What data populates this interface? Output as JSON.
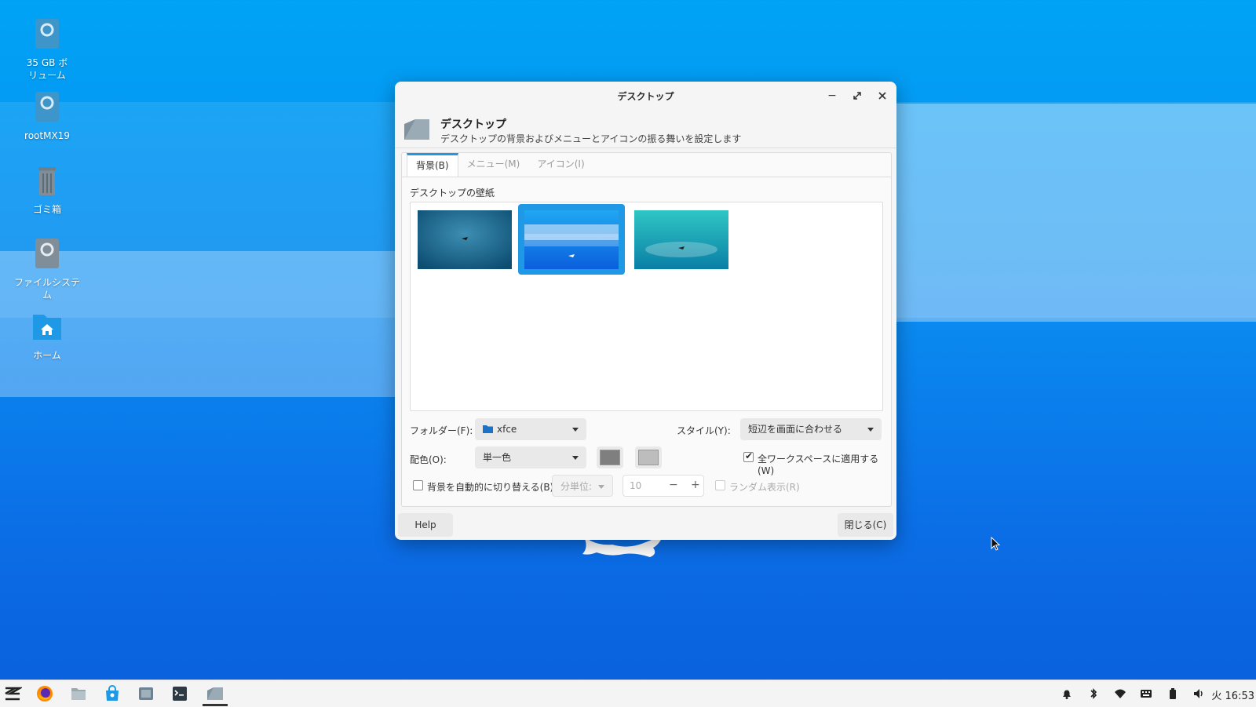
{
  "desktop": {
    "icons": [
      {
        "label": "35 GB ボ\nリューム",
        "icon": "drive-icon"
      },
      {
        "label": "rootMX19",
        "icon": "drive-icon"
      },
      {
        "label": "ゴミ箱",
        "icon": "trash-icon"
      },
      {
        "label": "ファイルシステ\nム",
        "icon": "drive-icon"
      },
      {
        "label": "ホーム",
        "icon": "home-folder-icon"
      }
    ]
  },
  "dialog": {
    "window_title": "デスクトップ",
    "header_title": "デスクトップ",
    "header_subtitle": "デスクトップの背景およびメニューとアイコンの振る舞いを設定します",
    "tabs": [
      "背景(B)",
      "メニュー(M)",
      "アイコン(I)"
    ],
    "active_tab": 0,
    "wallpaper_label": "デスクトップの壁紙",
    "selected_wallpaper": 1,
    "folder_label": "フォルダー(F):",
    "folder_value": "xfce",
    "style_label": "スタイル(Y):",
    "style_value": "短辺を画面に合わせる",
    "color_label": "配色(O):",
    "color_value": "単一色",
    "color1": "#7f7f7f",
    "color2": "#bdbdbd",
    "apply_all_label": "全ワークスペースに適用する(W)",
    "apply_all_checked": true,
    "auto_change_label": "背景を自動的に切り替える(B)",
    "auto_change_checked": false,
    "interval_unit": "分単位:",
    "interval_value": "10",
    "random_label": "ランダム表示(R)",
    "help_label": "Help",
    "close_label": "閉じる(C)"
  },
  "taskbar": {
    "clock": "火 16:53",
    "accent": "#1f98e6"
  }
}
